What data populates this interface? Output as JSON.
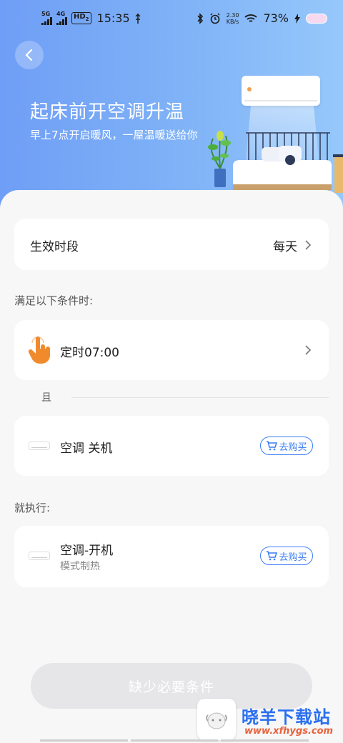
{
  "status_bar": {
    "net1": "5G",
    "net2": "4G",
    "hd": "HD",
    "hd_sub": "2",
    "time": "15:35",
    "speed_value": "2.30",
    "speed_unit": "KB/s",
    "battery": "73%"
  },
  "hero": {
    "title": "起床前开空调升温",
    "subtitle": "早上7点开启暖风，一屋温暖送给你"
  },
  "period_card": {
    "label": "生效时段",
    "value": "每天"
  },
  "conditions": {
    "header": "满足以下条件时:",
    "timer_label": "定时07:00",
    "and_label": "且",
    "device_label": "空调 关机",
    "buy_label": "去购买"
  },
  "actions": {
    "header": "就执行:",
    "device_label": "空调-开机",
    "device_sub": "模式制热",
    "buy_label": "去购买"
  },
  "submit": {
    "label": "缺少必要条件"
  },
  "watermark": {
    "title": "晓羊下载站",
    "url": "www.xfhygs.com"
  },
  "colors": {
    "accent": "#3a7cf3",
    "hero_start": "#6f9ef6",
    "hero_end": "#96c8fb",
    "hand_icon": "#f08a2c"
  }
}
